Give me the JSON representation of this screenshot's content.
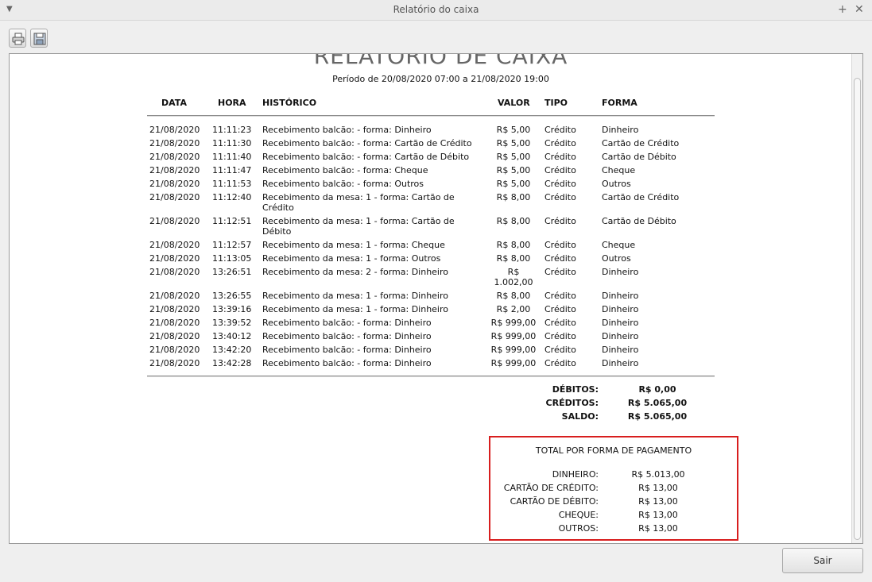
{
  "window": {
    "title": "Relatório do caixa"
  },
  "report": {
    "title": "RELATÓRIO DE CAIXA",
    "period": "Período de 20/08/2020 07:00 a 21/08/2020 19:00",
    "columns": [
      "DATA",
      "HORA",
      "HISTÓRICO",
      "VALOR",
      "TIPO",
      "FORMA"
    ],
    "rows": [
      {
        "date": "21/08/2020",
        "time": "11:11:23",
        "history": "Recebimento balcão: - forma: Dinheiro",
        "value": "R$ 5,00",
        "type": "Crédito",
        "form": "Dinheiro"
      },
      {
        "date": "21/08/2020",
        "time": "11:11:30",
        "history": "Recebimento balcão: - forma: Cartão de Crédito",
        "value": "R$ 5,00",
        "type": "Crédito",
        "form": "Cartão de Crédito"
      },
      {
        "date": "21/08/2020",
        "time": "11:11:40",
        "history": "Recebimento balcão: - forma: Cartão de Débito",
        "value": "R$ 5,00",
        "type": "Crédito",
        "form": "Cartão de Débito"
      },
      {
        "date": "21/08/2020",
        "time": "11:11:47",
        "history": "Recebimento balcão: - forma: Cheque",
        "value": "R$ 5,00",
        "type": "Crédito",
        "form": "Cheque"
      },
      {
        "date": "21/08/2020",
        "time": "11:11:53",
        "history": "Recebimento balcão: - forma: Outros",
        "value": "R$ 5,00",
        "type": "Crédito",
        "form": "Outros"
      },
      {
        "date": "21/08/2020",
        "time": "11:12:40",
        "history": "Recebimento da mesa: 1 - forma: Cartão de Crédito",
        "value": "R$ 8,00",
        "type": "Crédito",
        "form": "Cartão de Crédito"
      },
      {
        "date": "21/08/2020",
        "time": "11:12:51",
        "history": "Recebimento da mesa: 1 - forma: Cartão de Débito",
        "value": "R$ 8,00",
        "type": "Crédito",
        "form": "Cartão de Débito"
      },
      {
        "date": "21/08/2020",
        "time": "11:12:57",
        "history": "Recebimento da mesa: 1 - forma: Cheque",
        "value": "R$ 8,00",
        "type": "Crédito",
        "form": "Cheque"
      },
      {
        "date": "21/08/2020",
        "time": "11:13:05",
        "history": "Recebimento da mesa: 1 - forma: Outros",
        "value": "R$ 8,00",
        "type": "Crédito",
        "form": "Outros"
      },
      {
        "date": "21/08/2020",
        "time": "13:26:51",
        "history": "Recebimento da mesa: 2 - forma: Dinheiro",
        "value": "R$ 1.002,00",
        "type": "Crédito",
        "form": "Dinheiro"
      },
      {
        "date": "21/08/2020",
        "time": "13:26:55",
        "history": "Recebimento da mesa: 1 - forma: Dinheiro",
        "value": "R$ 8,00",
        "type": "Crédito",
        "form": "Dinheiro"
      },
      {
        "date": "21/08/2020",
        "time": "13:39:16",
        "history": "Recebimento da mesa: 1 - forma: Dinheiro",
        "value": "R$ 2,00",
        "type": "Crédito",
        "form": "Dinheiro"
      },
      {
        "date": "21/08/2020",
        "time": "13:39:52",
        "history": "Recebimento balcão: - forma: Dinheiro",
        "value": "R$ 999,00",
        "type": "Crédito",
        "form": "Dinheiro"
      },
      {
        "date": "21/08/2020",
        "time": "13:40:12",
        "history": "Recebimento balcão: - forma: Dinheiro",
        "value": "R$ 999,00",
        "type": "Crédito",
        "form": "Dinheiro"
      },
      {
        "date": "21/08/2020",
        "time": "13:42:20",
        "history": "Recebimento balcão: - forma: Dinheiro",
        "value": "R$ 999,00",
        "type": "Crédito",
        "form": "Dinheiro"
      },
      {
        "date": "21/08/2020",
        "time": "13:42:28",
        "history": "Recebimento balcão: - forma: Dinheiro",
        "value": "R$ 999,00",
        "type": "Crédito",
        "form": "Dinheiro"
      }
    ],
    "summary": [
      {
        "label": "DÉBITOS:",
        "value": "R$ 0,00"
      },
      {
        "label": "CRÉDITOS:",
        "value": "R$ 5.065,00"
      },
      {
        "label": "SALDO:",
        "value": "R$ 5.065,00"
      }
    ],
    "payment_totals": {
      "title": "TOTAL POR FORMA DE PAGAMENTO",
      "items": [
        {
          "label": "DINHEIRO:",
          "value": "R$ 5.013,00"
        },
        {
          "label": "CARTÃO DE CRÉDITO:",
          "value": "R$ 13,00"
        },
        {
          "label": "CARTÃO DE DÉBITO:",
          "value": "R$ 13,00"
        },
        {
          "label": "CHEQUE:",
          "value": "R$ 13,00"
        },
        {
          "label": "OUTROS:",
          "value": "R$ 13,00"
        }
      ]
    }
  },
  "footer": {
    "exit_label": "Sair"
  },
  "colors": {
    "highlight_border": "#d81e1e"
  }
}
